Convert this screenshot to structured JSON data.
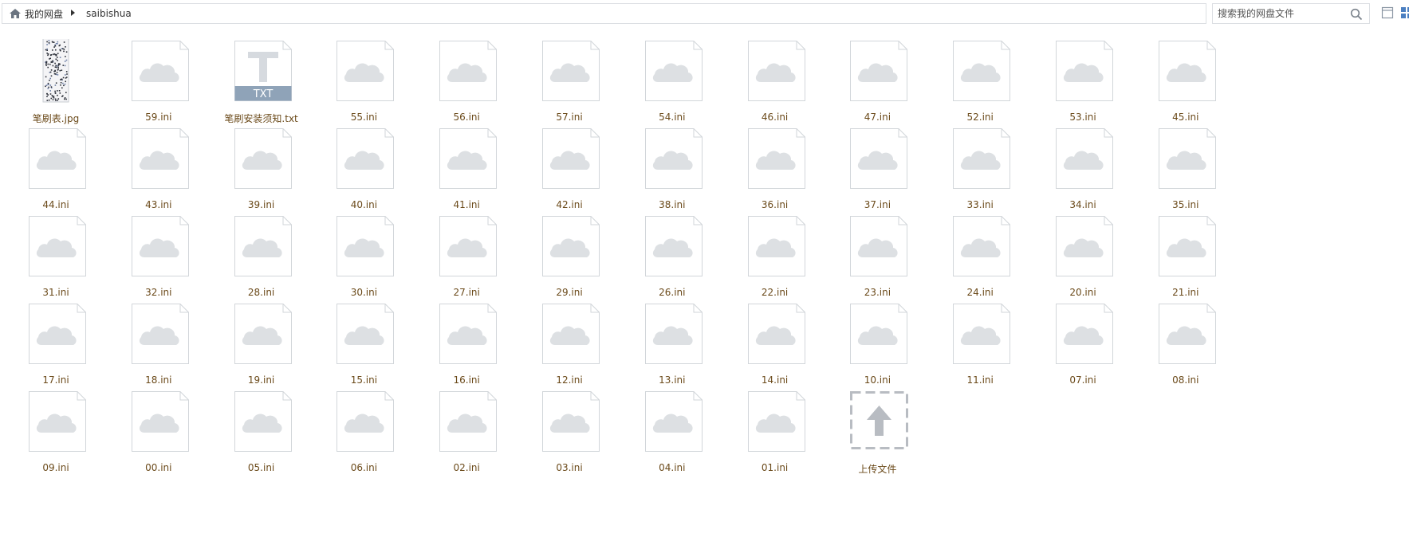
{
  "breadcrumb": {
    "home_label": "我的网盘",
    "current": "saibishua"
  },
  "search": {
    "placeholder": "搜索我的网盘文件"
  },
  "icons": {
    "home": "home-icon",
    "search": "search-icon",
    "list_view": "list-view-icon",
    "grid_view": "grid-view-icon",
    "file_default": "cloud-file-icon",
    "file_txt": "txt-file-icon",
    "file_jpg": "image-thumbnail-icon",
    "upload": "upload-arrow-icon"
  },
  "files": [
    {
      "name": "笔刷表.jpg",
      "type": "jpg"
    },
    {
      "name": "59.ini",
      "type": "ini"
    },
    {
      "name": "笔刷安装须知.txt",
      "type": "txt",
      "badge": "TXT"
    },
    {
      "name": "55.ini",
      "type": "ini"
    },
    {
      "name": "56.ini",
      "type": "ini"
    },
    {
      "name": "57.ini",
      "type": "ini"
    },
    {
      "name": "54.ini",
      "type": "ini"
    },
    {
      "name": "46.ini",
      "type": "ini"
    },
    {
      "name": "47.ini",
      "type": "ini"
    },
    {
      "name": "52.ini",
      "type": "ini"
    },
    {
      "name": "53.ini",
      "type": "ini"
    },
    {
      "name": "45.ini",
      "type": "ini"
    },
    {
      "name": "44.ini",
      "type": "ini"
    },
    {
      "name": "43.ini",
      "type": "ini"
    },
    {
      "name": "39.ini",
      "type": "ini"
    },
    {
      "name": "40.ini",
      "type": "ini"
    },
    {
      "name": "41.ini",
      "type": "ini"
    },
    {
      "name": "42.ini",
      "type": "ini"
    },
    {
      "name": "38.ini",
      "type": "ini"
    },
    {
      "name": "36.ini",
      "type": "ini"
    },
    {
      "name": "37.ini",
      "type": "ini"
    },
    {
      "name": "33.ini",
      "type": "ini"
    },
    {
      "name": "34.ini",
      "type": "ini"
    },
    {
      "name": "35.ini",
      "type": "ini"
    },
    {
      "name": "31.ini",
      "type": "ini"
    },
    {
      "name": "32.ini",
      "type": "ini"
    },
    {
      "name": "28.ini",
      "type": "ini"
    },
    {
      "name": "30.ini",
      "type": "ini"
    },
    {
      "name": "27.ini",
      "type": "ini"
    },
    {
      "name": "29.ini",
      "type": "ini"
    },
    {
      "name": "26.ini",
      "type": "ini"
    },
    {
      "name": "22.ini",
      "type": "ini"
    },
    {
      "name": "23.ini",
      "type": "ini"
    },
    {
      "name": "24.ini",
      "type": "ini"
    },
    {
      "name": "20.ini",
      "type": "ini"
    },
    {
      "name": "21.ini",
      "type": "ini"
    },
    {
      "name": "17.ini",
      "type": "ini"
    },
    {
      "name": "18.ini",
      "type": "ini"
    },
    {
      "name": "19.ini",
      "type": "ini"
    },
    {
      "name": "15.ini",
      "type": "ini"
    },
    {
      "name": "16.ini",
      "type": "ini"
    },
    {
      "name": "12.ini",
      "type": "ini"
    },
    {
      "name": "13.ini",
      "type": "ini"
    },
    {
      "name": "14.ini",
      "type": "ini"
    },
    {
      "name": "10.ini",
      "type": "ini"
    },
    {
      "name": "11.ini",
      "type": "ini"
    },
    {
      "name": "07.ini",
      "type": "ini"
    },
    {
      "name": "08.ini",
      "type": "ini"
    },
    {
      "name": "09.ini",
      "type": "ini"
    },
    {
      "name": "00.ini",
      "type": "ini"
    },
    {
      "name": "05.ini",
      "type": "ini"
    },
    {
      "name": "06.ini",
      "type": "ini"
    },
    {
      "name": "02.ini",
      "type": "ini"
    },
    {
      "name": "03.ini",
      "type": "ini"
    },
    {
      "name": "04.ini",
      "type": "ini"
    },
    {
      "name": "01.ini",
      "type": "ini"
    },
    {
      "name": "上传文件",
      "type": "upload"
    }
  ],
  "colors": {
    "label_text": "#6b4a1a",
    "border": "#dcdfe3",
    "cloud": "#dde0e3",
    "txt_badge": "#8fa3b8"
  }
}
